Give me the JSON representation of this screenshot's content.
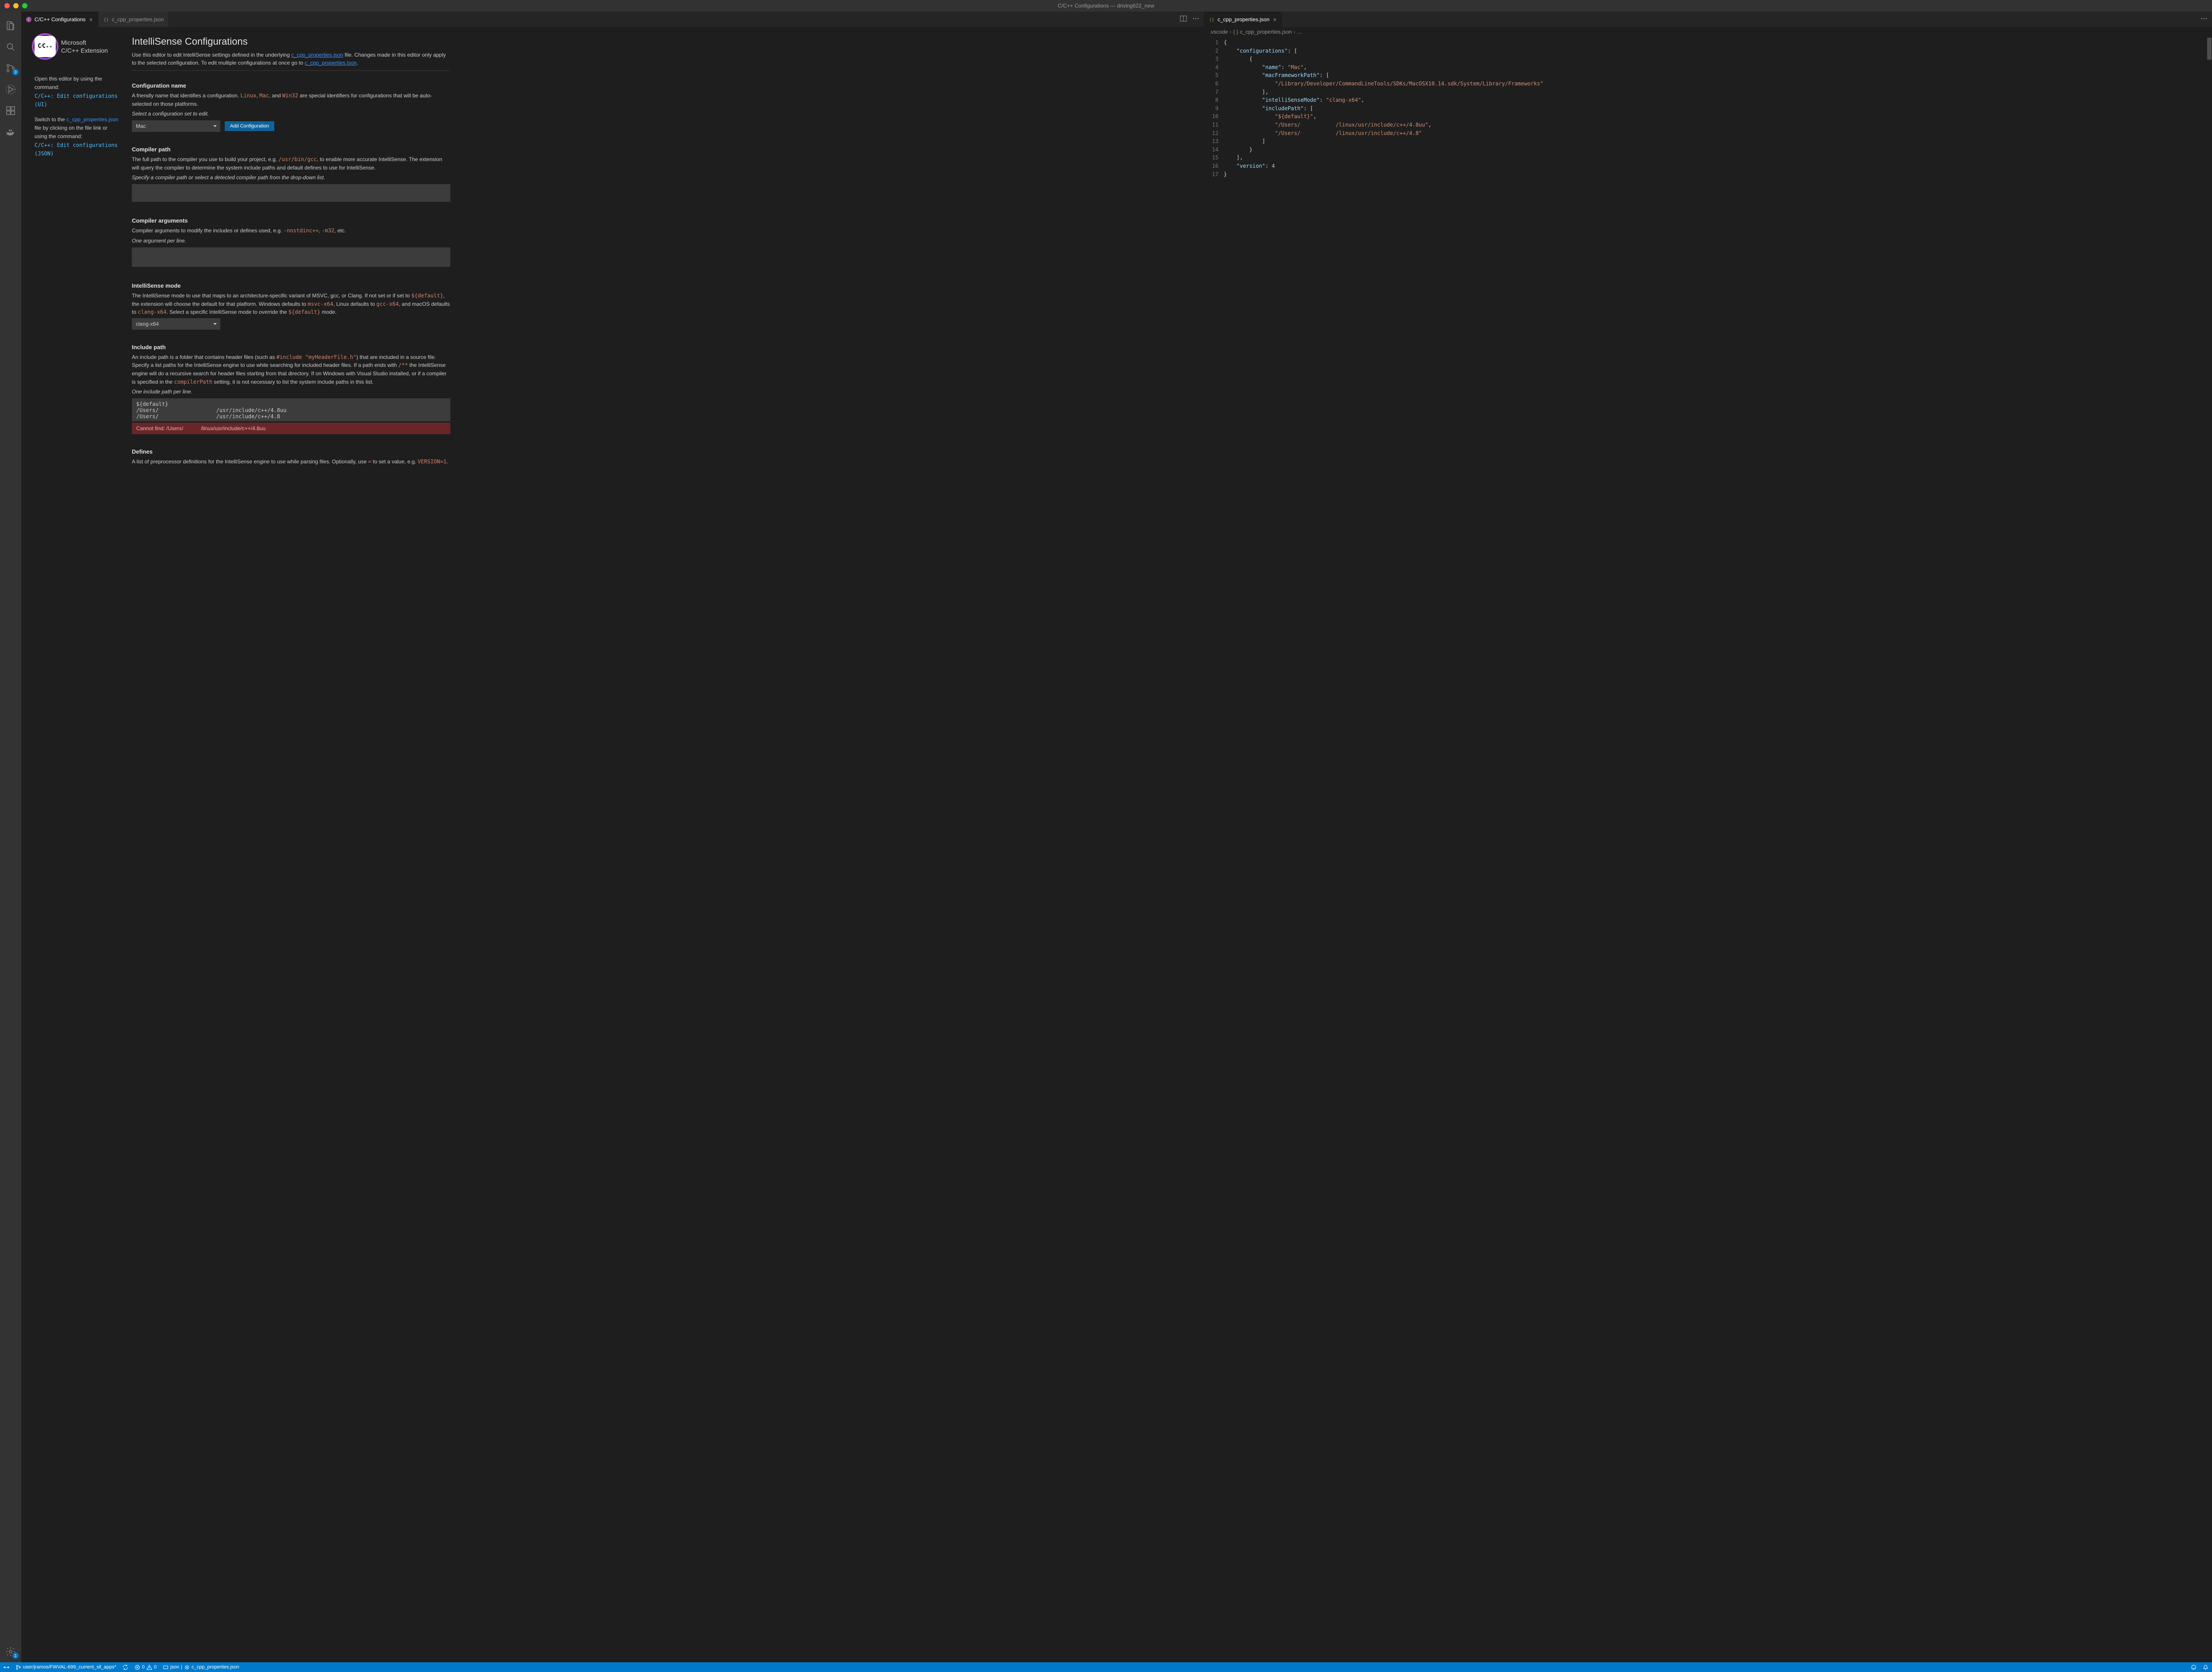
{
  "window_title": "C/C++ Configurations — driving622_new",
  "tabs_left": [
    {
      "label": "C/C++ Configurations",
      "active": true,
      "icon": "cpp"
    },
    {
      "label": "c_cpp_properties.json",
      "active": false,
      "icon": "json"
    }
  ],
  "tabs_right": [
    {
      "label": "c_cpp_properties.json",
      "active": true,
      "icon": "json"
    }
  ],
  "breadcrumbs": [
    ".vscode",
    "c_cpp_properties.json",
    "..."
  ],
  "logo": {
    "line1": "Microsoft",
    "line2": "C/C++ Extension",
    "glyph": "C⁄C₊₊"
  },
  "sidebar_help": {
    "p1": "Open this editor by using the command:",
    "cmd1": "C/C++: Edit configurations (UI)",
    "p2_a": "Switch to the ",
    "p2_link": "c_cpp_properties.json",
    "p2_b": " file by clicking on the file link or using the command:",
    "cmd2": "C/C++: Edit configurations (JSON)"
  },
  "header": {
    "title": "IntelliSense Configurations",
    "intro_a": "Use this editor to edit IntelliSense settings defined in the underlying ",
    "intro_link1": "c_cpp_properties.json",
    "intro_b": " file. Changes made in this editor only apply to the selected configuration. To edit multiple configurations at once go to ",
    "intro_link2": "c_cpp_properties.json",
    "intro_c": "."
  },
  "sections": {
    "config_name": {
      "title": "Configuration name",
      "desc_a": "A friendly name that identifies a configuration. ",
      "code1": "Linux",
      "sep1": ", ",
      "code2": "Mac",
      "sep2": ", and ",
      "code3": "Win32",
      "desc_b": " are special identifiers for configurations that will be auto-selected on those platforms.",
      "hint": "Select a configuration set to edit.",
      "value": "Mac",
      "add_btn": "Add Configuration"
    },
    "compiler_path": {
      "title": "Compiler path",
      "desc_a": "The full path to the compiler you use to build your project, e.g. ",
      "code1": "/usr/bin/gcc",
      "desc_b": ", to enable more accurate IntelliSense. The extension will query the compiler to determine the system include paths and default defines to use for IntelliSense.",
      "hint": "Specify a compiler path or select a detected compiler path from the drop-down list.",
      "value": ""
    },
    "compiler_args": {
      "title": "Compiler arguments",
      "desc_a": "Compiler arguments to modify the includes or defines used, e.g. ",
      "code1": "-nostdinc++",
      "sep1": ", ",
      "code2": "-m32",
      "desc_b": ", etc.",
      "hint": "One argument per line.",
      "value": ""
    },
    "intellisense_mode": {
      "title": "IntelliSense mode",
      "desc_a": "The IntelliSense mode to use that maps to an architecture-specific variant of MSVC, gcc, or Clang. If not set or if set to ",
      "code1": "${default}",
      "desc_b": ", the extension will choose the default for that platform. Windows defaults to ",
      "code2": "msvc-x64",
      "desc_c": ", Linux defaults to ",
      "code3": "gcc-x64",
      "desc_d": ", and macOS defaults to ",
      "code4": "clang-x64",
      "desc_e": ". Select a specific IntelliSense mode to override the ",
      "code5": "${default}",
      "desc_f": " mode.",
      "value": "clang-x64"
    },
    "include_path": {
      "title": "Include path",
      "desc_a": "An include path is a folder that contains header files (such as ",
      "code1": "#include \"myHeaderFile.h\"",
      "desc_b": ") that are included in a source file. Specify a list paths for the IntelliSense engine to use while searching for included header files. If a path ends with ",
      "code2": "/**",
      "desc_c": " the IntelliSense engine will do a recursive search for header files starting from that directory. If on Windows with Visual Studio installed, or if a compiler is specified in the ",
      "code3": "compilerPath",
      "desc_d": " setting, it is not necessary to list the system include paths in this list.",
      "hint": "One include path per line.",
      "value": "${default}\n/Users/                  /usr/include/c++/4.8uu\n/Users/                  /usr/include/c++/4.8",
      "error_label": "Cannot find: /Users/",
      "error_path": "/linux/usr/include/c++/4.8uu"
    },
    "defines": {
      "title": "Defines",
      "desc_a": "A list of preprocessor definitions for the IntelliSense engine to use while parsing files. Optionally, use ",
      "code1": "=",
      "desc_b": " to set a value, e.g. ",
      "code2": "VERSION=1",
      "desc_c": "."
    }
  },
  "code": {
    "lines": [
      "{",
      "    \"configurations\": [",
      "        {",
      "            \"name\": \"Mac\",",
      "            \"macFrameworkPath\": [",
      "                \"/Library/Developer/CommandLineTools/SDKs/MacOSX10.14.sdk/System/Library/Frameworks\"",
      "            ],",
      "            \"intelliSenseMode\": \"clang-x64\",",
      "            \"includePath\": [",
      "                \"${default}\",",
      "                \"/Users/           /linux/usr/include/c++/4.8uu\",",
      "                \"/Users/           /linux/usr/include/c++/4.8\"",
      "            ]",
      "        }",
      "    ],",
      "    \"version\": 4",
      "}"
    ]
  },
  "statusbar": {
    "branch": "user/jramos/FWVAL-699_current_sil_apps*",
    "errors": "0",
    "warnings": "0",
    "lang": "json",
    "file": "c_cpp_properties.json"
  },
  "activity_badges": {
    "scm": "3",
    "settings": "1"
  }
}
